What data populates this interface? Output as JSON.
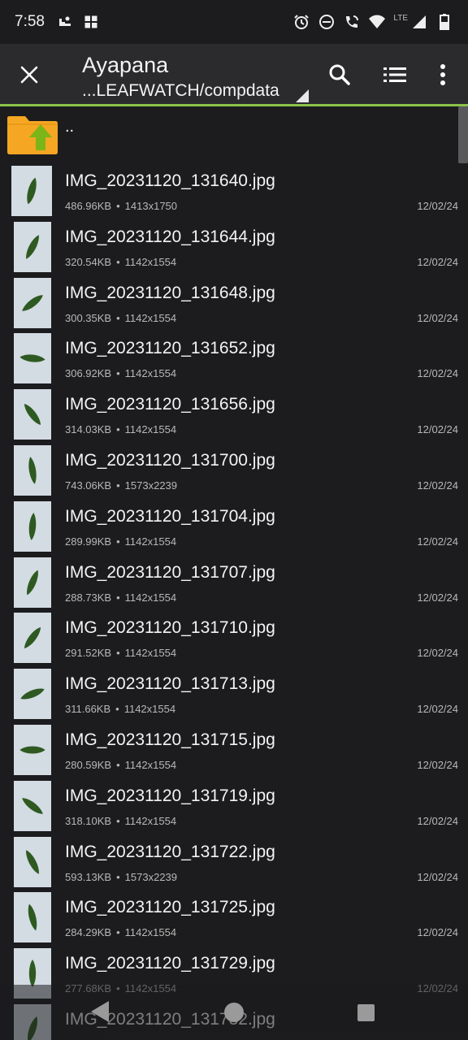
{
  "status_bar": {
    "time": "7:58",
    "network_label": "LTE"
  },
  "app_bar": {
    "title": "Ayapana",
    "path": "...LEAFWATCH/compdata",
    "icons": [
      "close-icon",
      "search-icon",
      "list-view-icon",
      "more-vert-icon"
    ]
  },
  "parent_dir": {
    "label": ".."
  },
  "files": [
    {
      "name": "IMG_20231120_131640.jpg",
      "size": "486.96KB",
      "dims": "1413x1750",
      "date": "12/02/24",
      "leaf_angle": 15
    },
    {
      "name": "IMG_20231120_131644.jpg",
      "size": "320.54KB",
      "dims": "1142x1554",
      "date": "12/02/24",
      "leaf_angle": 30
    },
    {
      "name": "IMG_20231120_131648.jpg",
      "size": "300.35KB",
      "dims": "1142x1554",
      "date": "12/02/24",
      "leaf_angle": 55
    },
    {
      "name": "IMG_20231120_131652.jpg",
      "size": "306.92KB",
      "dims": "1142x1554",
      "date": "12/02/24",
      "leaf_angle": 95
    },
    {
      "name": "IMG_20231120_131656.jpg",
      "size": "314.03KB",
      "dims": "1142x1554",
      "date": "12/02/24",
      "leaf_angle": 140
    },
    {
      "name": "IMG_20231120_131700.jpg",
      "size": "743.06KB",
      "dims": "1573x2239",
      "date": "12/02/24",
      "leaf_angle": 170
    },
    {
      "name": "IMG_20231120_131704.jpg",
      "size": "289.99KB",
      "dims": "1142x1554",
      "date": "12/02/24",
      "leaf_angle": 5
    },
    {
      "name": "IMG_20231120_131707.jpg",
      "size": "288.73KB",
      "dims": "1142x1554",
      "date": "12/02/24",
      "leaf_angle": 25
    },
    {
      "name": "IMG_20231120_131710.jpg",
      "size": "291.52KB",
      "dims": "1142x1554",
      "date": "12/02/24",
      "leaf_angle": 40
    },
    {
      "name": "IMG_20231120_131713.jpg",
      "size": "311.66KB",
      "dims": "1142x1554",
      "date": "12/02/24",
      "leaf_angle": 70
    },
    {
      "name": "IMG_20231120_131715.jpg",
      "size": "280.59KB",
      "dims": "1142x1554",
      "date": "12/02/24",
      "leaf_angle": 90
    },
    {
      "name": "IMG_20231120_131719.jpg",
      "size": "318.10KB",
      "dims": "1142x1554",
      "date": "12/02/24",
      "leaf_angle": 125
    },
    {
      "name": "IMG_20231120_131722.jpg",
      "size": "593.13KB",
      "dims": "1573x2239",
      "date": "12/02/24",
      "leaf_angle": 150
    },
    {
      "name": "IMG_20231120_131725.jpg",
      "size": "284.29KB",
      "dims": "1142x1554",
      "date": "12/02/24",
      "leaf_angle": 165
    },
    {
      "name": "IMG_20231120_131729.jpg",
      "size": "277.68KB",
      "dims": "1142x1554",
      "date": "12/02/24",
      "leaf_angle": 0
    },
    {
      "name": "IMG_20231120_131732.jpg",
      "size": "",
      "dims": "",
      "date": "",
      "leaf_angle": 20
    }
  ],
  "colors": {
    "accent": "#8bc34a",
    "folder": "#f5a623",
    "leaf": "#2e5a22"
  }
}
